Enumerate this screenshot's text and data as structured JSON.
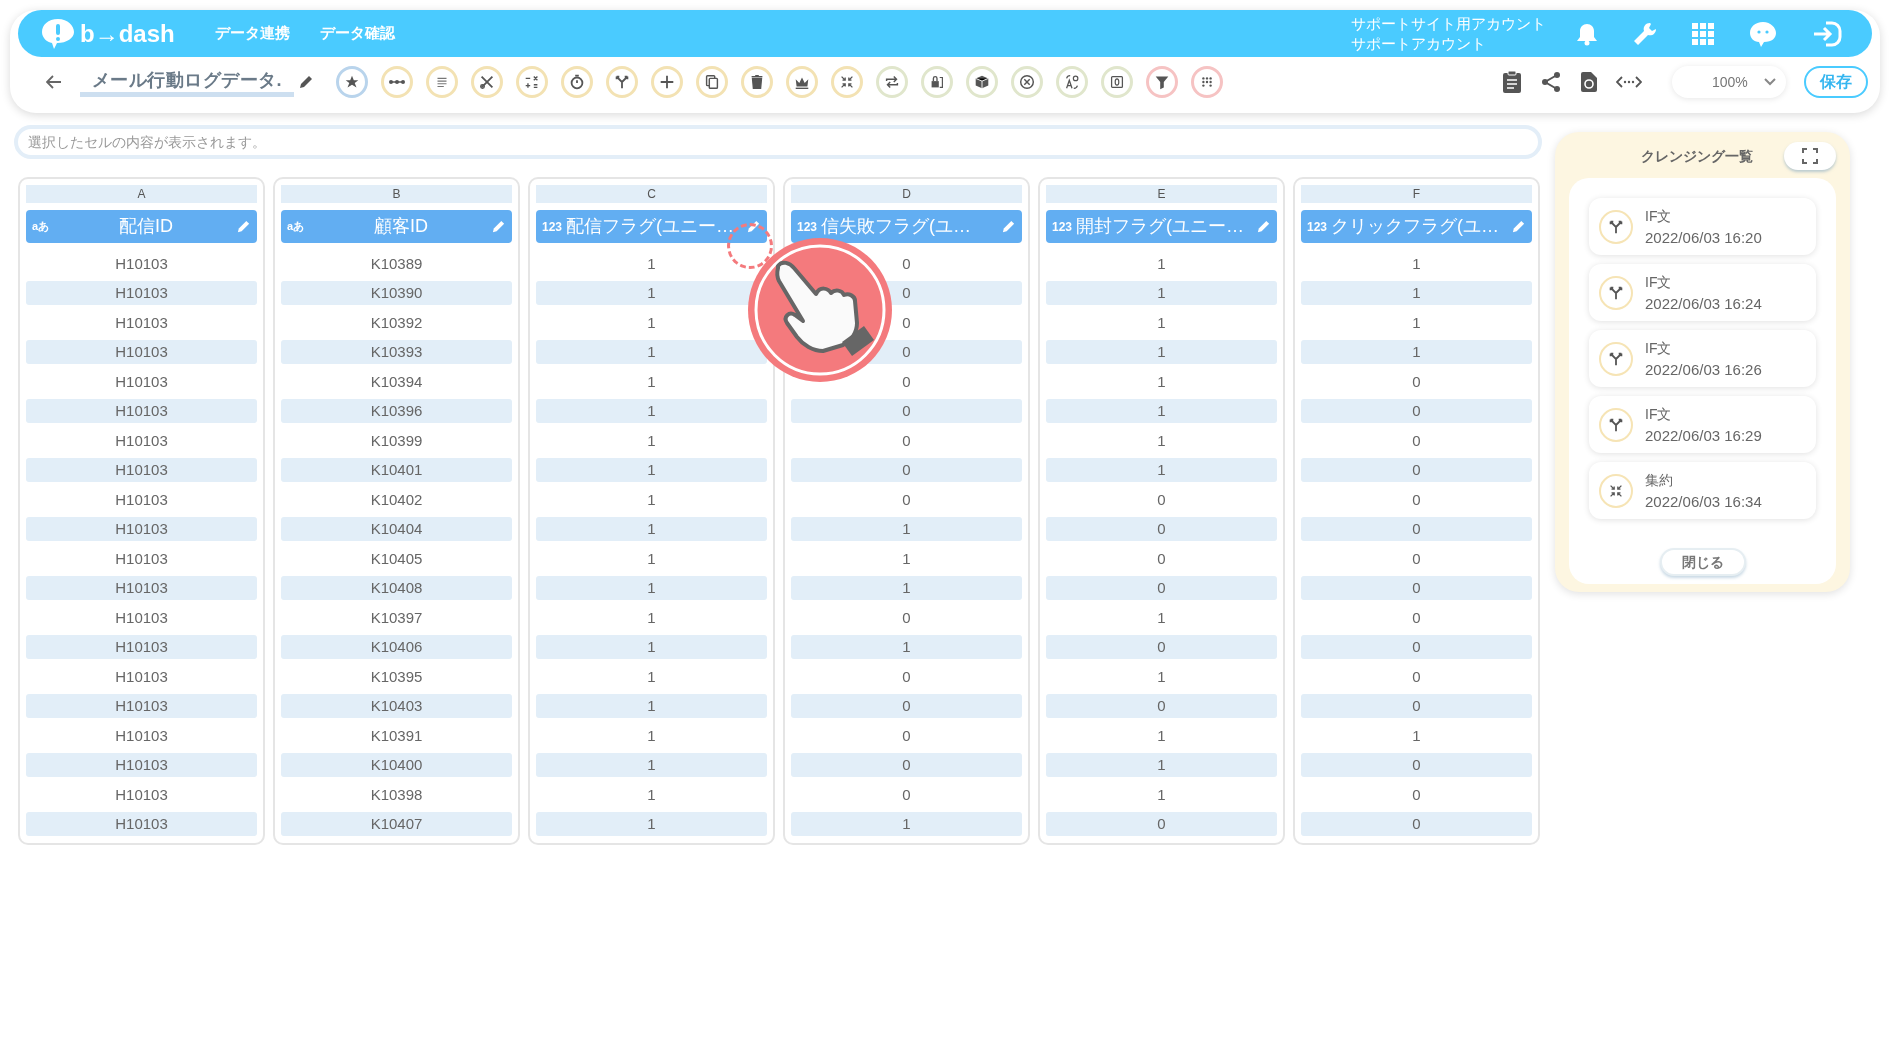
{
  "header": {
    "logo": "b→dash",
    "nav": [
      "データ連携",
      "データ確認"
    ],
    "account": [
      "サポートサイト用アカウント",
      "サポートアカウント"
    ]
  },
  "toolbar": {
    "title": "メール行動ログデータ.",
    "tools": [
      {
        "kind": "star",
        "color": "#b9d4ec"
      },
      {
        "kind": "dots",
        "color": "#f3e2b3"
      },
      {
        "kind": "lines",
        "color": "#f3e2b3"
      },
      {
        "kind": "tools",
        "color": "#f3e2b3"
      },
      {
        "kind": "calc",
        "color": "#f3e2b3"
      },
      {
        "kind": "timer",
        "color": "#f3e2b3"
      },
      {
        "kind": "branch",
        "color": "#f3e2b3"
      },
      {
        "kind": "plus",
        "color": "#f3e2b3"
      },
      {
        "kind": "copy",
        "color": "#f3e2b3"
      },
      {
        "kind": "trash",
        "color": "#f3e2b3"
      },
      {
        "kind": "crown",
        "color": "#f3e2b3"
      },
      {
        "kind": "collapse",
        "color": "#f3e2b3"
      },
      {
        "kind": "repeat",
        "color": "#e0e6cc"
      },
      {
        "kind": "lock",
        "color": "#e0e6cc"
      },
      {
        "kind": "box",
        "color": "#e0e6cc"
      },
      {
        "kind": "xcircle",
        "color": "#e0e6cc"
      },
      {
        "kind": "translate",
        "color": "#e0e6cc"
      },
      {
        "kind": "zero",
        "color": "#e0e6cc"
      },
      {
        "kind": "filter",
        "color": "#f6c3c3"
      },
      {
        "kind": "grid",
        "color": "#f6c3c3"
      }
    ],
    "zoom": "100%",
    "save": "保存"
  },
  "formula_bar": {
    "placeholder": "選択したセルの内容が表示されます。"
  },
  "table": {
    "columns": [
      {
        "letter": "A",
        "kind": "text",
        "type_mark": "aあ",
        "name": "配信ID"
      },
      {
        "letter": "B",
        "kind": "text",
        "type_mark": "aあ",
        "name": "顧客ID"
      },
      {
        "letter": "C",
        "kind": "number",
        "type_mark": "123",
        "name": "配信フラグ(ユニー…"
      },
      {
        "letter": "D",
        "kind": "number",
        "type_mark": "123",
        "name": "信失敗フラグ(ユ…"
      },
      {
        "letter": "E",
        "kind": "number",
        "type_mark": "123",
        "name": "開封フラグ(ユニー…"
      },
      {
        "letter": "F",
        "kind": "number",
        "type_mark": "123",
        "name": "クリックフラグ(ユ…"
      }
    ],
    "rows": [
      [
        "H10103",
        "K10389",
        "1",
        "0",
        "1",
        "1"
      ],
      [
        "H10103",
        "K10390",
        "1",
        "0",
        "1",
        "1"
      ],
      [
        "H10103",
        "K10392",
        "1",
        "0",
        "1",
        "1"
      ],
      [
        "H10103",
        "K10393",
        "1",
        "0",
        "1",
        "1"
      ],
      [
        "H10103",
        "K10394",
        "1",
        "0",
        "1",
        "0"
      ],
      [
        "H10103",
        "K10396",
        "1",
        "0",
        "1",
        "0"
      ],
      [
        "H10103",
        "K10399",
        "1",
        "0",
        "1",
        "0"
      ],
      [
        "H10103",
        "K10401",
        "1",
        "0",
        "1",
        "0"
      ],
      [
        "H10103",
        "K10402",
        "1",
        "0",
        "0",
        "0"
      ],
      [
        "H10103",
        "K10404",
        "1",
        "1",
        "0",
        "0"
      ],
      [
        "H10103",
        "K10405",
        "1",
        "1",
        "0",
        "0"
      ],
      [
        "H10103",
        "K10408",
        "1",
        "1",
        "0",
        "0"
      ],
      [
        "H10103",
        "K10397",
        "1",
        "0",
        "1",
        "0"
      ],
      [
        "H10103",
        "K10406",
        "1",
        "1",
        "0",
        "0"
      ],
      [
        "H10103",
        "K10395",
        "1",
        "0",
        "1",
        "0"
      ],
      [
        "H10103",
        "K10403",
        "1",
        "0",
        "0",
        "0"
      ],
      [
        "H10103",
        "K10391",
        "1",
        "0",
        "1",
        "1"
      ],
      [
        "H10103",
        "K10400",
        "1",
        "0",
        "1",
        "0"
      ],
      [
        "H10103",
        "K10398",
        "1",
        "0",
        "1",
        "0"
      ],
      [
        "H10103",
        "K10407",
        "1",
        "1",
        "0",
        "0"
      ]
    ]
  },
  "cleansing_panel": {
    "title": "クレンジング一覧",
    "items": [
      {
        "kind": "branch",
        "name": "IF文",
        "time": "2022/06/03 16:20"
      },
      {
        "kind": "branch",
        "name": "IF文",
        "time": "2022/06/03 16:24"
      },
      {
        "kind": "branch",
        "name": "IF文",
        "time": "2022/06/03 16:26"
      },
      {
        "kind": "branch",
        "name": "IF文",
        "time": "2022/06/03 16:29"
      },
      {
        "kind": "collapse",
        "name": "集約",
        "time": "2022/06/03 16:34"
      }
    ],
    "close": "閉じる"
  }
}
